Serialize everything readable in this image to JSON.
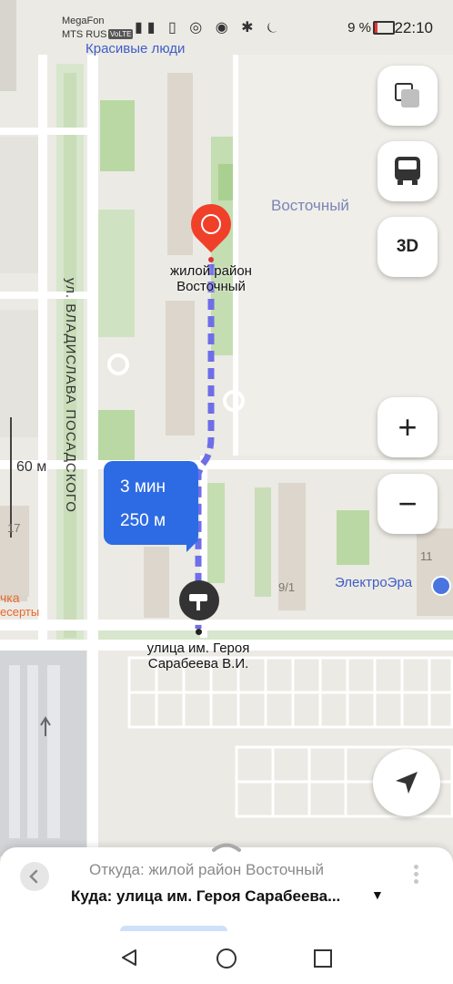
{
  "status_bar": {
    "operator_1": "MegaFon",
    "operator_2": "MTS RUS",
    "volte": "VoLTE",
    "battery_percent": "9 %",
    "time": "22:10"
  },
  "map": {
    "labels": {
      "top_place": "Красивые люди",
      "district": "Восточный",
      "street_vertical": "ул. ВЛАДИСЛАВА ПОСАДСКОГО",
      "scale": "60 м",
      "house_17": "17",
      "house_9_1": "9/1",
      "house_11": "11",
      "poi_electro": "ЭлектроЭра",
      "poi_left_1": "чка",
      "poi_left_2": "есерты"
    },
    "origin_label_line1": "жилой район",
    "origin_label_line2": "Восточный",
    "dest_label_line1": "улица им. Героя",
    "dest_label_line2": "Сарабеева В.И.",
    "route_card": {
      "time": "3 мин",
      "distance": "250 м"
    },
    "route_color": "#6e6ee8",
    "origin_pin_color": "#f0402a",
    "card_color": "#2d6be4"
  },
  "controls": {
    "layers_icon": "layers-icon",
    "transport_icon": "bus-icon",
    "view_3d": "3D",
    "zoom_in": "+",
    "zoom_out": "−",
    "locate_icon": "navigation-arrow-icon"
  },
  "sheet": {
    "from": "Откуда: жилой район Восточный",
    "to": "Куда: улица им. Героя Сарабеева..."
  },
  "nav": {
    "back": "back-icon",
    "home": "home-icon",
    "recents": "recents-icon"
  }
}
